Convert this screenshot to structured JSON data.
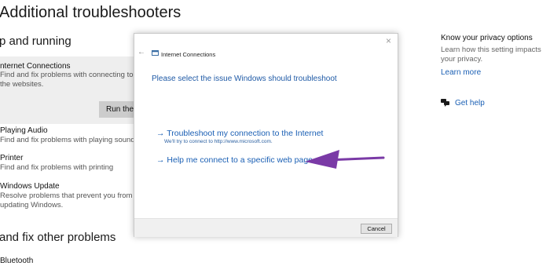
{
  "page": {
    "title": "Additional troubleshooters"
  },
  "sections": {
    "get_up": "p and running",
    "find_fix": "and fix other problems"
  },
  "items": [
    {
      "title": "nternet Connections",
      "desc": "Find and fix problems with connecting to the websites."
    },
    {
      "title": "Playing Audio",
      "desc": "Find and fix problems with playing sound"
    },
    {
      "title": "Printer",
      "desc": "Find and fix problems with printing"
    },
    {
      "title": "Windows Update",
      "desc": "Resolve problems that prevent you from updating Windows."
    }
  ],
  "run_button": "Run the t",
  "bottom_item": "Bluetooth",
  "right": {
    "privacy_title": "Know your privacy options",
    "privacy_desc": "Learn how this setting impacts your privacy.",
    "learn_more": "Learn more",
    "get_help": "Get help"
  },
  "dialog": {
    "close": "×",
    "back": "←",
    "title": "Internet Connections",
    "heading": "Please select the issue Windows should troubleshoot",
    "options": [
      {
        "label": "→ Troubleshoot my connection to the Internet",
        "sub": "We'll try to connect to http://www.microsoft.com."
      },
      {
        "label": "→ Help me connect to a specific web page"
      }
    ],
    "cancel": "Cancel"
  },
  "colors": {
    "accent": "#1a5fb4",
    "arrow": "#7a3aa6"
  },
  "icons": {
    "window": "window-icon",
    "help": "chat-help-icon",
    "arrow": "purple-arrow-icon"
  }
}
